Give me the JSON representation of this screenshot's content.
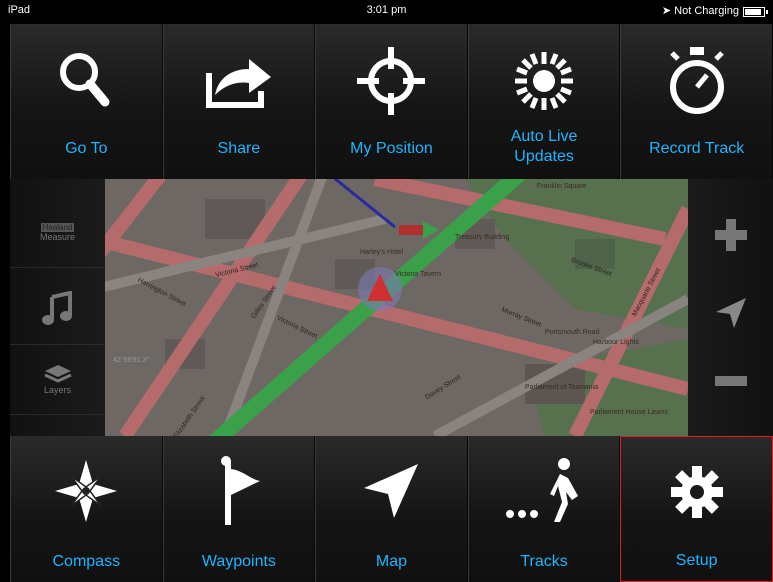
{
  "status_bar": {
    "device": "iPad",
    "time": "3:01 pm",
    "charging": "Not Charging",
    "battery_level": 0.9
  },
  "top_menu": [
    {
      "label": "Go To",
      "icon": "search-icon"
    },
    {
      "label": "Share",
      "icon": "share-icon"
    },
    {
      "label": "My Position",
      "icon": "crosshair-icon"
    },
    {
      "label": "Auto Live Updates",
      "icon": "sun-burst-icon"
    },
    {
      "label": "Record Track",
      "icon": "stopwatch-icon"
    }
  ],
  "bottom_menu": [
    {
      "label": "Compass",
      "icon": "compass-rose-icon"
    },
    {
      "label": "Waypoints",
      "icon": "flag-icon"
    },
    {
      "label": "Map",
      "icon": "navigation-arrow-icon"
    },
    {
      "label": "Tracks",
      "icon": "walking-person-icon"
    },
    {
      "label": "Setup",
      "icon": "gear-icon",
      "selected": true
    }
  ],
  "left_sidebar": {
    "measure_label": "Measure",
    "measure_tag": "Haaland",
    "music_icon": "music-note-icon",
    "layers_label": "Layers",
    "coordinate_text": "42°58'51.3\""
  },
  "right_sidebar": [
    {
      "icon": "zoom-in-icon"
    },
    {
      "icon": "navigation-arrow-icon"
    },
    {
      "icon": "zoom-out-icon"
    }
  ],
  "map": {
    "streets": [
      "Victoria Street",
      "Harrington Street",
      "Gilles Street",
      "Victoria Street",
      "Murray Street",
      "Brooke Street",
      "Macquarie Street",
      "Davey Street",
      "Elizabeth Street"
    ],
    "places": [
      "Harley's Hotel",
      "Victoria Tavern",
      "Franklin Square",
      "Harbour Lights",
      "Portsmouth Road",
      "Parliament of Tasmania",
      "Parliament House Lawns",
      "Treasury Building"
    ],
    "colors": {
      "main_road": "#3aa04a",
      "secondary_road": "#c87070",
      "park": "#4f6f4a",
      "accent": "#1fb4ff"
    }
  }
}
